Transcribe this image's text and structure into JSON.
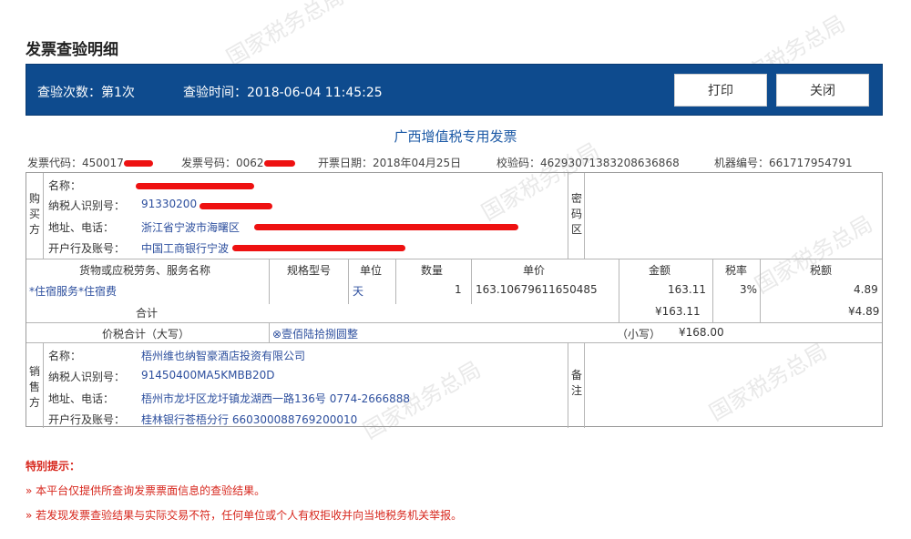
{
  "page": {
    "title": "发票查验明细"
  },
  "header": {
    "count_label": "查验次数：第1次",
    "time_label": "查验时间：2018-06-04 11:45:25",
    "print_label": "打印",
    "close_label": "关闭"
  },
  "invoice": {
    "title": "广西增值税专用发票",
    "code_label": "发票代码：",
    "code_value": "450017",
    "number_label": "发票号码：",
    "number_value": "0062",
    "date_label": "开票日期：",
    "date_value": "2018年04月25日",
    "check_label": "校验码：",
    "check_value": "46293071383208636868",
    "machine_label": "机器编号：",
    "machine_value": "661717954791"
  },
  "buyer": {
    "section": [
      "购",
      "买",
      "方"
    ],
    "name_label": "名称：",
    "taxid_label": "纳税人识别号：",
    "taxid_value": "91330200",
    "addr_label": "地址、电话：",
    "addr_value": "浙江省宁波市海曙区",
    "bank_label": "开户行及账号：",
    "bank_value": "中国工商银行宁波"
  },
  "password_section": [
    "密",
    "码",
    "区"
  ],
  "items": {
    "headers": [
      "货物或应税劳务、服务名称",
      "规格型号",
      "单位",
      "数量",
      "单价",
      "金额",
      "税率",
      "税额"
    ],
    "rows": [
      {
        "name": "*住宿服务*住宿费",
        "spec": "",
        "unit": "天",
        "qty": "1",
        "price": "163.10679611650485",
        "amount": "163.11",
        "rate": "3%",
        "tax": "4.89"
      }
    ],
    "total_label": "合计",
    "total_amount": "¥163.11",
    "total_tax": "¥4.89"
  },
  "grand_total": {
    "label": "价税合计（大写）",
    "upper": "⊗壹佰陆拾捌圆整",
    "small_label": "（小写）",
    "small_value": "¥168.00"
  },
  "seller": {
    "section": [
      "销",
      "售",
      "方"
    ],
    "name_label": "名称：",
    "name_value": "梧州维也纳智豪酒店投资有限公司",
    "taxid_label": "纳税人识别号：",
    "taxid_value": "91450400MA5KMBB20D",
    "addr_label": "地址、电话：",
    "addr_value": "梧州市龙圩区龙圩镇龙湖西一路136号 0774-2666888",
    "bank_label": "开户行及账号：",
    "bank_value": "桂林银行苍梧分行 660300088769200010"
  },
  "remarks_section": [
    "备",
    "注"
  ],
  "notes": {
    "title": "特别提示：",
    "items": [
      "»  本平台仅提供所查询发票票面信息的查验结果。",
      "»  若发现发票查验结果与实际交易不符，任何单位或个人有权拒收并向当地税务机关举报。"
    ]
  },
  "watermark": {
    "text": "国家税务总局"
  },
  "colors": {
    "header_bg": "#0e4b8e",
    "accent_blue": "#1d5aa6",
    "warning_red": "#d7261c"
  }
}
